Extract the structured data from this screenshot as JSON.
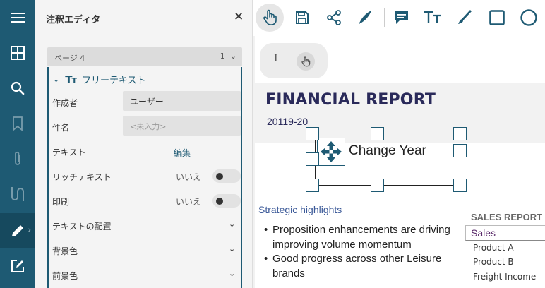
{
  "rail": {
    "items": [
      {
        "name": "menu-icon",
        "active": false
      },
      {
        "name": "grid-icon",
        "active": false
      },
      {
        "name": "search-icon",
        "active": false
      },
      {
        "name": "bookmark-icon",
        "active": false
      },
      {
        "name": "attachment-icon",
        "active": false
      },
      {
        "name": "signature-icon",
        "active": false
      },
      {
        "name": "pen-icon",
        "active": true
      },
      {
        "name": "edit-form-icon",
        "active": false
      }
    ],
    "colors": {
      "background": "#1e5a73",
      "active": "#16495e"
    }
  },
  "panel": {
    "title": "注釈エディタ",
    "close": "✕",
    "page_select": {
      "label": "ページ 4",
      "value": "1"
    },
    "group": {
      "title": "フリーテキスト",
      "author_label": "作成者",
      "author_value": "ユーザー",
      "subject_label": "件名",
      "subject_placeholder": "<未入力>",
      "text_label": "テキスト",
      "text_link": "編集",
      "rich_label": "リッチテキスト",
      "rich_value": "いいえ",
      "print_label": "印刷",
      "print_value": "いいえ",
      "align_label": "テキストの配置",
      "bg_label": "背景色",
      "fg_label": "前景色"
    }
  },
  "toolbar": {
    "items": [
      "hand-tool-icon",
      "save-icon",
      "share-icon",
      "ink-pen-icon",
      "comment-icon",
      "free-text-icon",
      "brush-icon",
      "square-icon",
      "circle-icon"
    ],
    "active": "hand-tool-icon"
  },
  "document": {
    "mini_tools": {
      "cursor": "I"
    },
    "title": "FINANCIAL REPORT",
    "year": "20119-20",
    "annotation_text": "Change Year",
    "strategic_heading": "Strategic highlights",
    "bullets": [
      "Proposition enhancements are driving improving volume momentum",
      "Good progress across other Leisure brands"
    ],
    "sales": {
      "title": "SALES REPORT",
      "header": "Sales",
      "rows": [
        "Product A",
        "Product B",
        "Freight Income"
      ]
    },
    "colors": {
      "title": "#2a2a5a",
      "heading": "#3b5998",
      "accent": "#1e5a73"
    }
  }
}
